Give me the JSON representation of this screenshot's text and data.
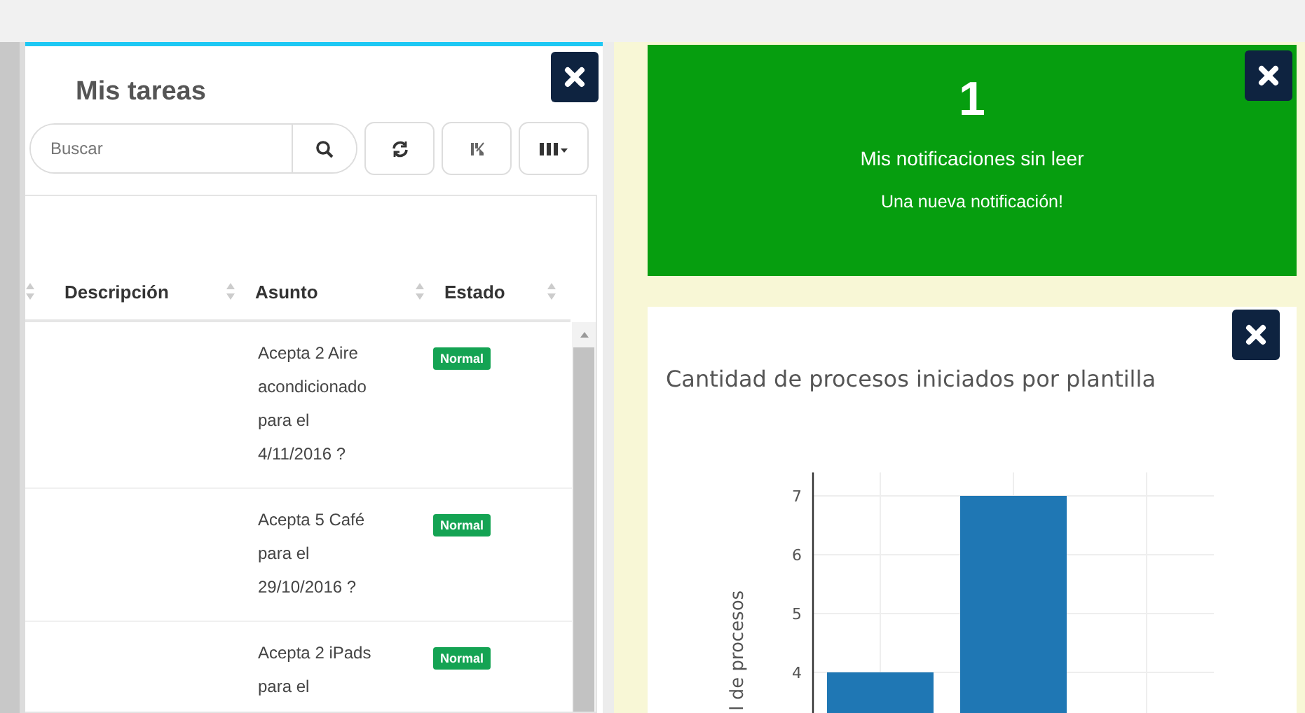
{
  "tasks_panel": {
    "title": "Mis tareas",
    "search": {
      "placeholder": "Buscar"
    },
    "table": {
      "columns": [
        {
          "label": "Descripción"
        },
        {
          "label": "Asunto"
        },
        {
          "label": "Estado"
        }
      ],
      "rows": [
        {
          "asunto": "Acepta 2 Aire acondicionado para el 4/11/2016 ?",
          "estado": "Normal"
        },
        {
          "asunto": "Acepta 5 Café para el 29/10/2016 ?",
          "estado": "Normal"
        },
        {
          "asunto": "Acepta 2 iPads para el",
          "estado": "Normal"
        }
      ]
    }
  },
  "notifications": {
    "count": "1",
    "title": "Mis notificaciones sin leer",
    "message": "Una nueva notificación!"
  },
  "chart_panel": {
    "title": "Cantidad de procesos iniciados por plantilla",
    "chart_data": {
      "type": "bar",
      "ylabel": "l de procesos",
      "values": [
        4,
        7
      ],
      "yticks": [
        4,
        5,
        6,
        7
      ],
      "ylim": [
        3.3,
        7.4
      ],
      "grid": true
    }
  }
}
